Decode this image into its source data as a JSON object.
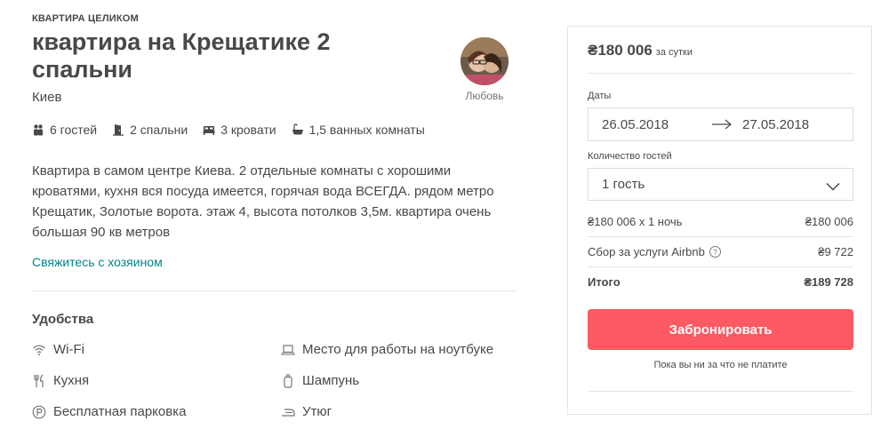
{
  "listing": {
    "kicker": "КВАРТИРА ЦЕЛИКОМ",
    "title": "квартира на Крещатике 2 спальни",
    "city": "Киев",
    "host_name": "Любовь",
    "stats": {
      "guests": "6 гостей",
      "bedrooms": "2 спальни",
      "beds": "3 кровати",
      "baths": "1,5 ванных комнаты"
    },
    "description": "Квартира в самом центре Киева. 2 отдельные комнаты с хорошими кроватями, кухня вся посуда имеется, горячая вода ВСЕГДА. рядом метро Крещатик, Золотые ворота. этаж 4, высота потолков 3,5м. квартира очень большая 90 кв метров",
    "contact_link": "Свяжитесь с хозяином"
  },
  "amenities": {
    "title": "Удобства",
    "items": [
      {
        "label": "Wi-Fi",
        "icon": "wifi-icon"
      },
      {
        "label": "Место для работы на ноутбуке",
        "icon": "laptop-icon"
      },
      {
        "label": "Кухня",
        "icon": "kitchen-icon"
      },
      {
        "label": "Шампунь",
        "icon": "shampoo-icon"
      },
      {
        "label": "Бесплатная парковка",
        "icon": "parking-icon"
      },
      {
        "label": "Утюг",
        "icon": "iron-icon"
      }
    ]
  },
  "booking": {
    "price": "₴180 006",
    "per_night": "за сутки",
    "dates_label": "Даты",
    "checkin": "26.05.2018",
    "checkout": "27.05.2018",
    "guests_label": "Количество гостей",
    "guests_value": "1 гость",
    "nightly_calc": "₴180 006 x 1 ночь",
    "nightly_total": "₴180 006",
    "service_fee_label": "Сбор за услуги Airbnb",
    "service_fee": "₴9 722",
    "total_label": "Итого",
    "total": "₴189 728",
    "book_button": "Забронировать",
    "note": "Пока вы ни за что не платите"
  },
  "colors": {
    "accent": "#fc5a63",
    "link": "#008489",
    "text": "#484848"
  }
}
